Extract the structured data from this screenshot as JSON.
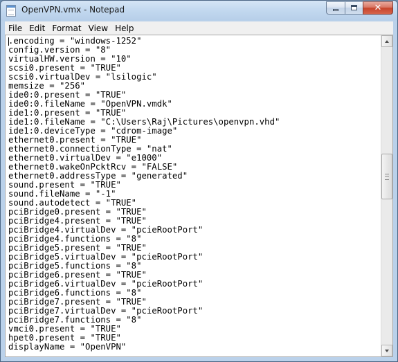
{
  "window": {
    "title": "OpenVPN.vmx - Notepad",
    "icon": "notepad-icon",
    "controls": {
      "minimize": "minimize-icon",
      "maximize": "maximize-icon",
      "close_glyph": "✕"
    }
  },
  "menubar": {
    "items": [
      "File",
      "Edit",
      "Format",
      "View",
      "Help"
    ]
  },
  "document": {
    "lines": [
      ".encoding = \"windows-1252\"",
      "config.version = \"8\"",
      "virtualHW.version = \"10\"",
      "scsi0.present = \"TRUE\"",
      "scsi0.virtualDev = \"lsilogic\"",
      "memsize = \"256\"",
      "ide0:0.present = \"TRUE\"",
      "ide0:0.fileName = \"OpenVPN.vmdk\"",
      "ide1:0.present = \"TRUE\"",
      "ide1:0.fileName = \"C:\\Users\\Raj\\Pictures\\openvpn.vhd\"",
      "ide1:0.deviceType = \"cdrom-image\"",
      "ethernet0.present = \"TRUE\"",
      "ethernet0.connectionType = \"nat\"",
      "ethernet0.virtualDev = \"e1000\"",
      "ethernet0.wakeOnPcktRcv = \"FALSE\"",
      "ethernet0.addressType = \"generated\"",
      "sound.present = \"TRUE\"",
      "sound.fileName = \"-1\"",
      "sound.autodetect = \"TRUE\"",
      "pciBridge0.present = \"TRUE\"",
      "pciBridge4.present = \"TRUE\"",
      "pciBridge4.virtualDev = \"pcieRootPort\"",
      "pciBridge4.functions = \"8\"",
      "pciBridge5.present = \"TRUE\"",
      "pciBridge5.virtualDev = \"pcieRootPort\"",
      "pciBridge5.functions = \"8\"",
      "pciBridge6.present = \"TRUE\"",
      "pciBridge6.virtualDev = \"pcieRootPort\"",
      "pciBridge6.functions = \"8\"",
      "pciBridge7.present = \"TRUE\"",
      "pciBridge7.virtualDev = \"pcieRootPort\"",
      "pciBridge7.functions = \"8\"",
      "vmci0.present = \"TRUE\"",
      "hpet0.present = \"TRUE\"",
      "displayName = \"OpenVPN\""
    ]
  },
  "scrollbar": {
    "up_icon": "scroll-up-arrow-icon",
    "down_icon": "scroll-down-arrow-icon"
  }
}
